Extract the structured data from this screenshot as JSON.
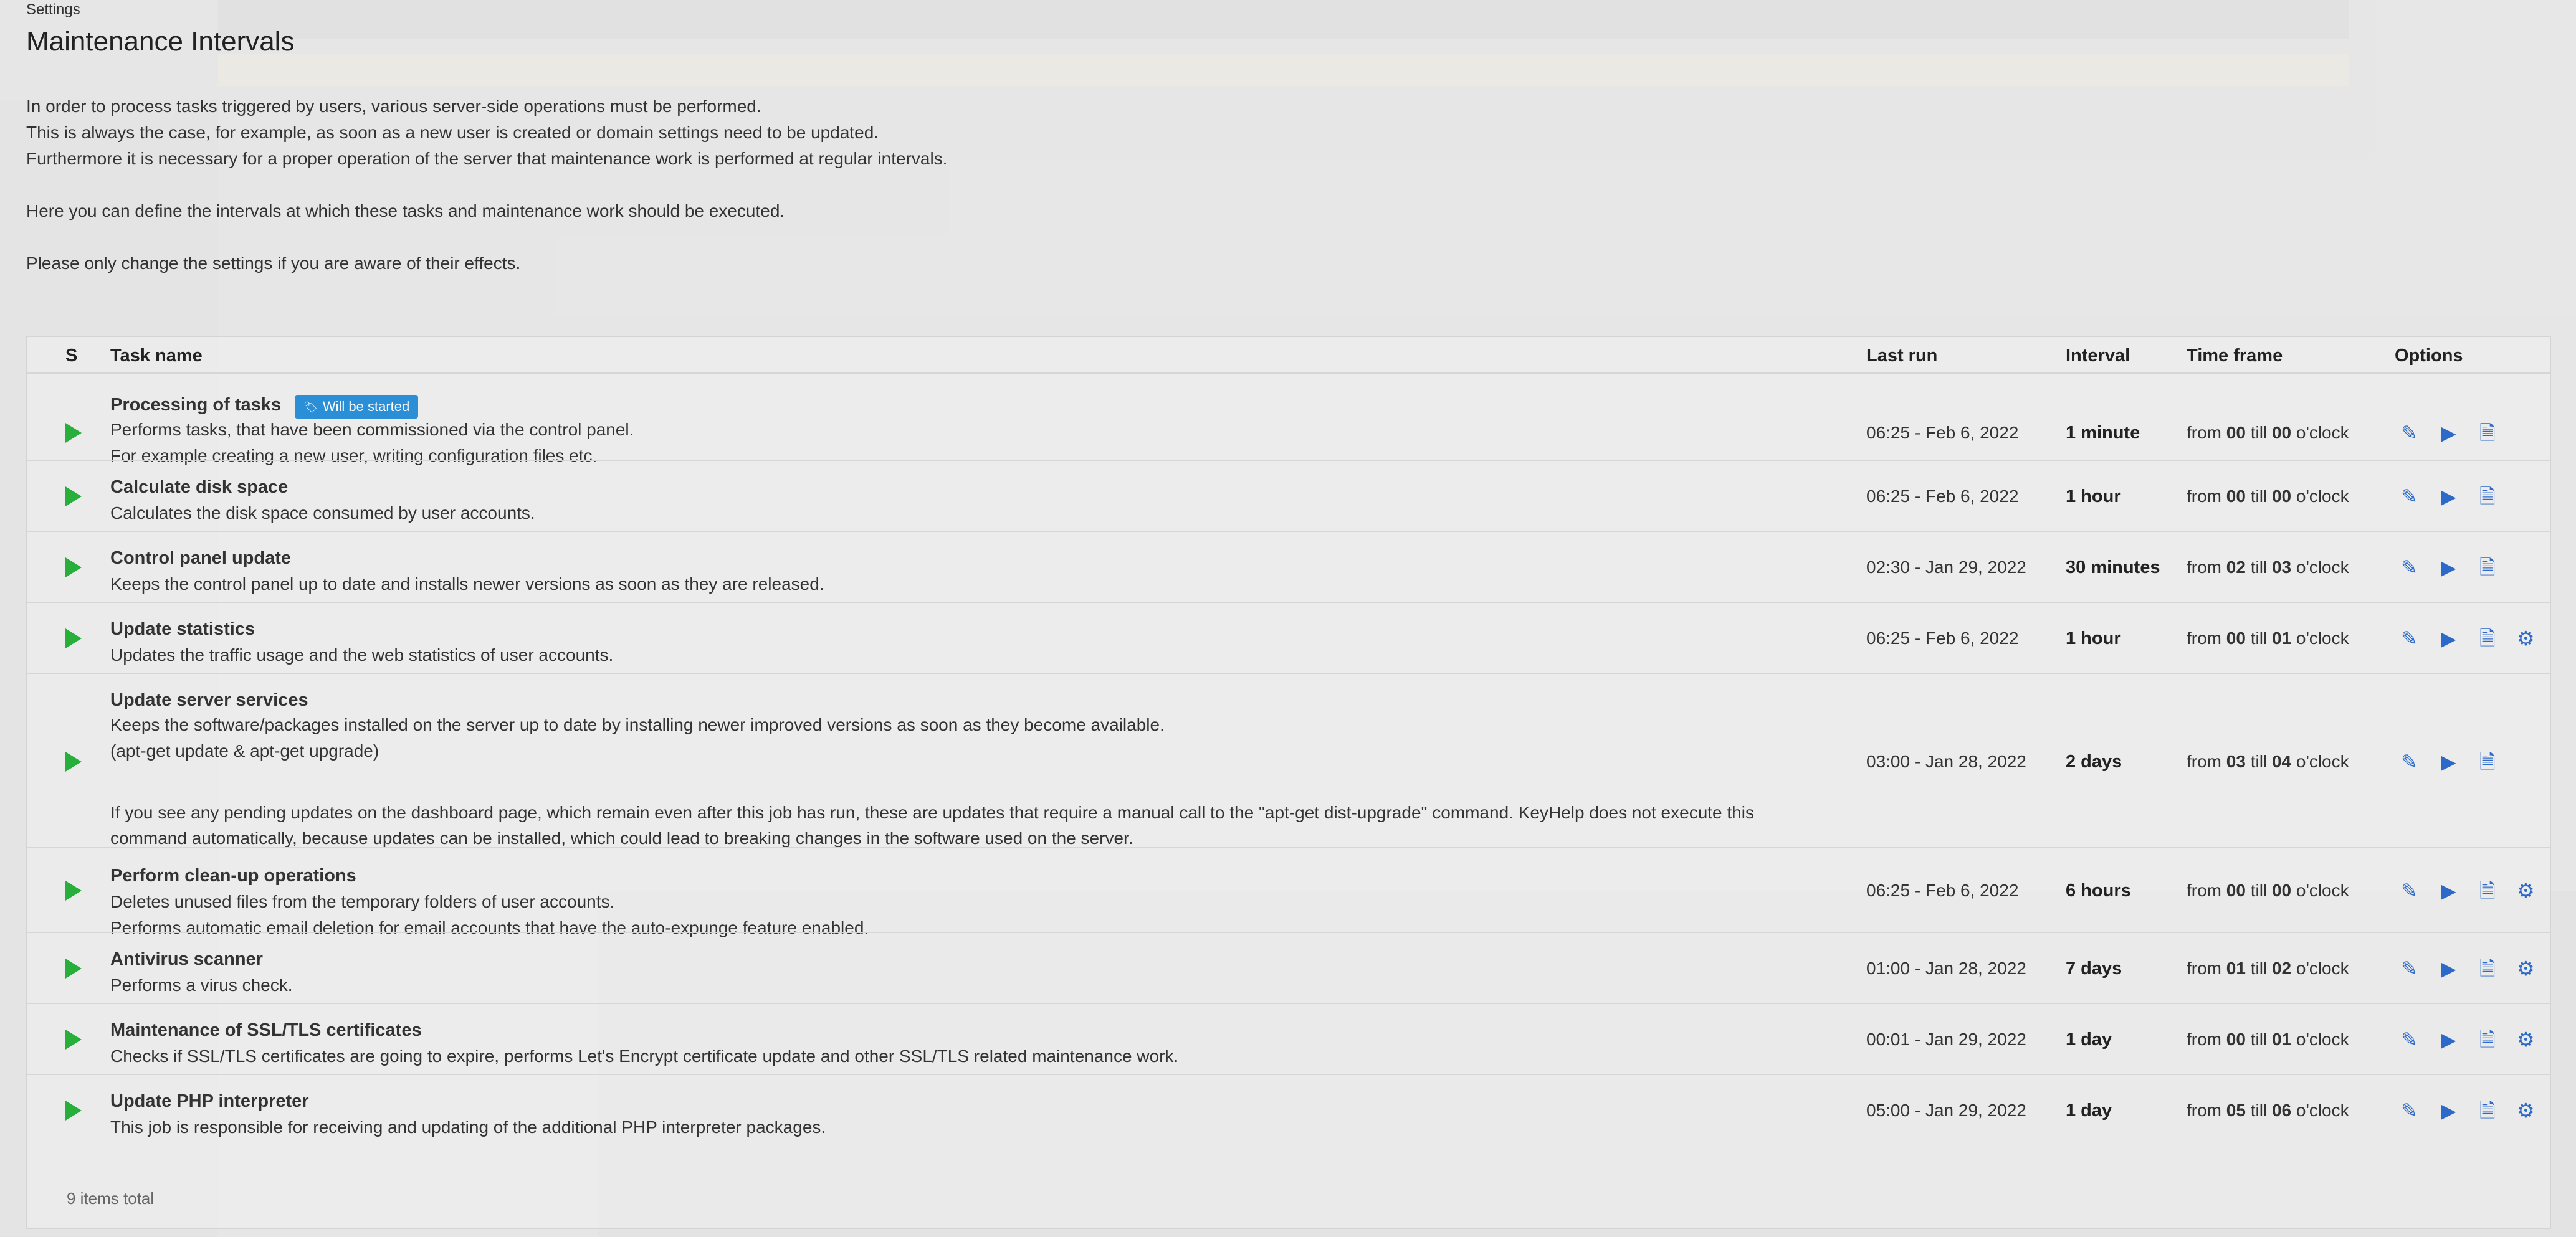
{
  "page": {
    "settings_label": "Settings",
    "title": "Maintenance Intervals",
    "intro": [
      "In order to process tasks triggered by users, various server-side operations must be performed.",
      "This is always the case, for example, as soon as a new user is created or domain settings need to be updated.",
      "Furthermore it is necessary for a proper operation of the server that maintenance work is performed at regular intervals.",
      "Here you can define the intervals at which these tasks and maintenance work should be executed.",
      "Please only change the settings if you are aware of their effects."
    ]
  },
  "table": {
    "headers": {
      "status": "S",
      "task": "Task name",
      "last_run": "Last run",
      "interval": "Interval",
      "time_frame": "Time frame",
      "options": "Options"
    },
    "time_frame_words": {
      "from": "from",
      "till": "till",
      "oclock": "o'clock"
    },
    "rows": [
      {
        "name": "Processing of tasks",
        "badge": "Will be started",
        "desc1": "Performs tasks, that have been commissioned via the control panel.",
        "desc2": "For example creating a new user, writing configuration files etc.",
        "last_run": "06:25 - Feb 6, 2022",
        "interval": "1 minute",
        "from": "00",
        "till": "00"
      },
      {
        "name": "Calculate disk space",
        "desc1": "Calculates the disk space consumed by user accounts.",
        "last_run": "06:25 - Feb 6, 2022",
        "interval": "1 hour",
        "from": "00",
        "till": "00"
      },
      {
        "name": "Control panel update",
        "desc1": "Keeps the control panel up to date and installs newer versions as soon as they are released.",
        "last_run": "02:30 - Jan 29, 2022",
        "interval": "30 minutes",
        "from": "02",
        "till": "03"
      },
      {
        "name": "Update statistics",
        "desc1": "Updates the traffic usage and the web statistics of user accounts.",
        "last_run": "06:25 - Feb 6, 2022",
        "interval": "1 hour",
        "from": "00",
        "till": "01"
      },
      {
        "name": "Update server services",
        "desc1": "Keeps the software/packages installed on the server up to date by installing newer improved versions as soon as they become available.",
        "desc2": "(apt-get update & apt-get upgrade)",
        "desc3": "If you see any pending updates on the dashboard page, which remain even after this job has run, these are updates that require a manual call to the \"apt-get dist-upgrade\" command. KeyHelp does not execute this",
        "desc4": "command automatically, because updates can be installed, which could lead to breaking changes in the software used on the server.",
        "last_run": "03:00 - Jan 28, 2022",
        "interval": "2 days",
        "from": "03",
        "till": "04"
      },
      {
        "name": "Perform clean-up operations",
        "desc1": "Deletes unused files from the temporary folders of user accounts.",
        "desc2": "Performs automatic email deletion for email accounts that have the auto-expunge feature enabled.",
        "last_run": "06:25 - Feb 6, 2022",
        "interval": "6 hours",
        "from": "00",
        "till": "00"
      },
      {
        "name": "Antivirus scanner",
        "desc1": "Performs a virus check.",
        "last_run": "01:00 - Jan 28, 2022",
        "interval": "7 days",
        "from": "01",
        "till": "02"
      },
      {
        "name": "Maintenance of SSL/TLS certificates",
        "desc1": "Checks if SSL/TLS certificates are going to expire, performs Let's Encrypt certificate update and other SSL/TLS related maintenance work.",
        "last_run": "00:01 - Jan 29, 2022",
        "interval": "1 day",
        "from": "00",
        "till": "01"
      },
      {
        "name": "Update PHP interpreter",
        "desc1": "This job is responsible for receiving and updating of the additional PHP interpreter packages.",
        "last_run": "05:00 - Jan 29, 2022",
        "interval": "1 day",
        "from": "05",
        "till": "06"
      }
    ],
    "footer": "9 items total"
  },
  "icons": {
    "edit": "pencil-icon",
    "run": "play-icon",
    "log": "document-icon",
    "settings": "gear-icon",
    "status": "play-status-icon",
    "badge": "tag-icon"
  },
  "colors": {
    "accent": "#2c69c9",
    "status_play": "#27ae3b",
    "badge_bg": "#2a8fd6"
  }
}
